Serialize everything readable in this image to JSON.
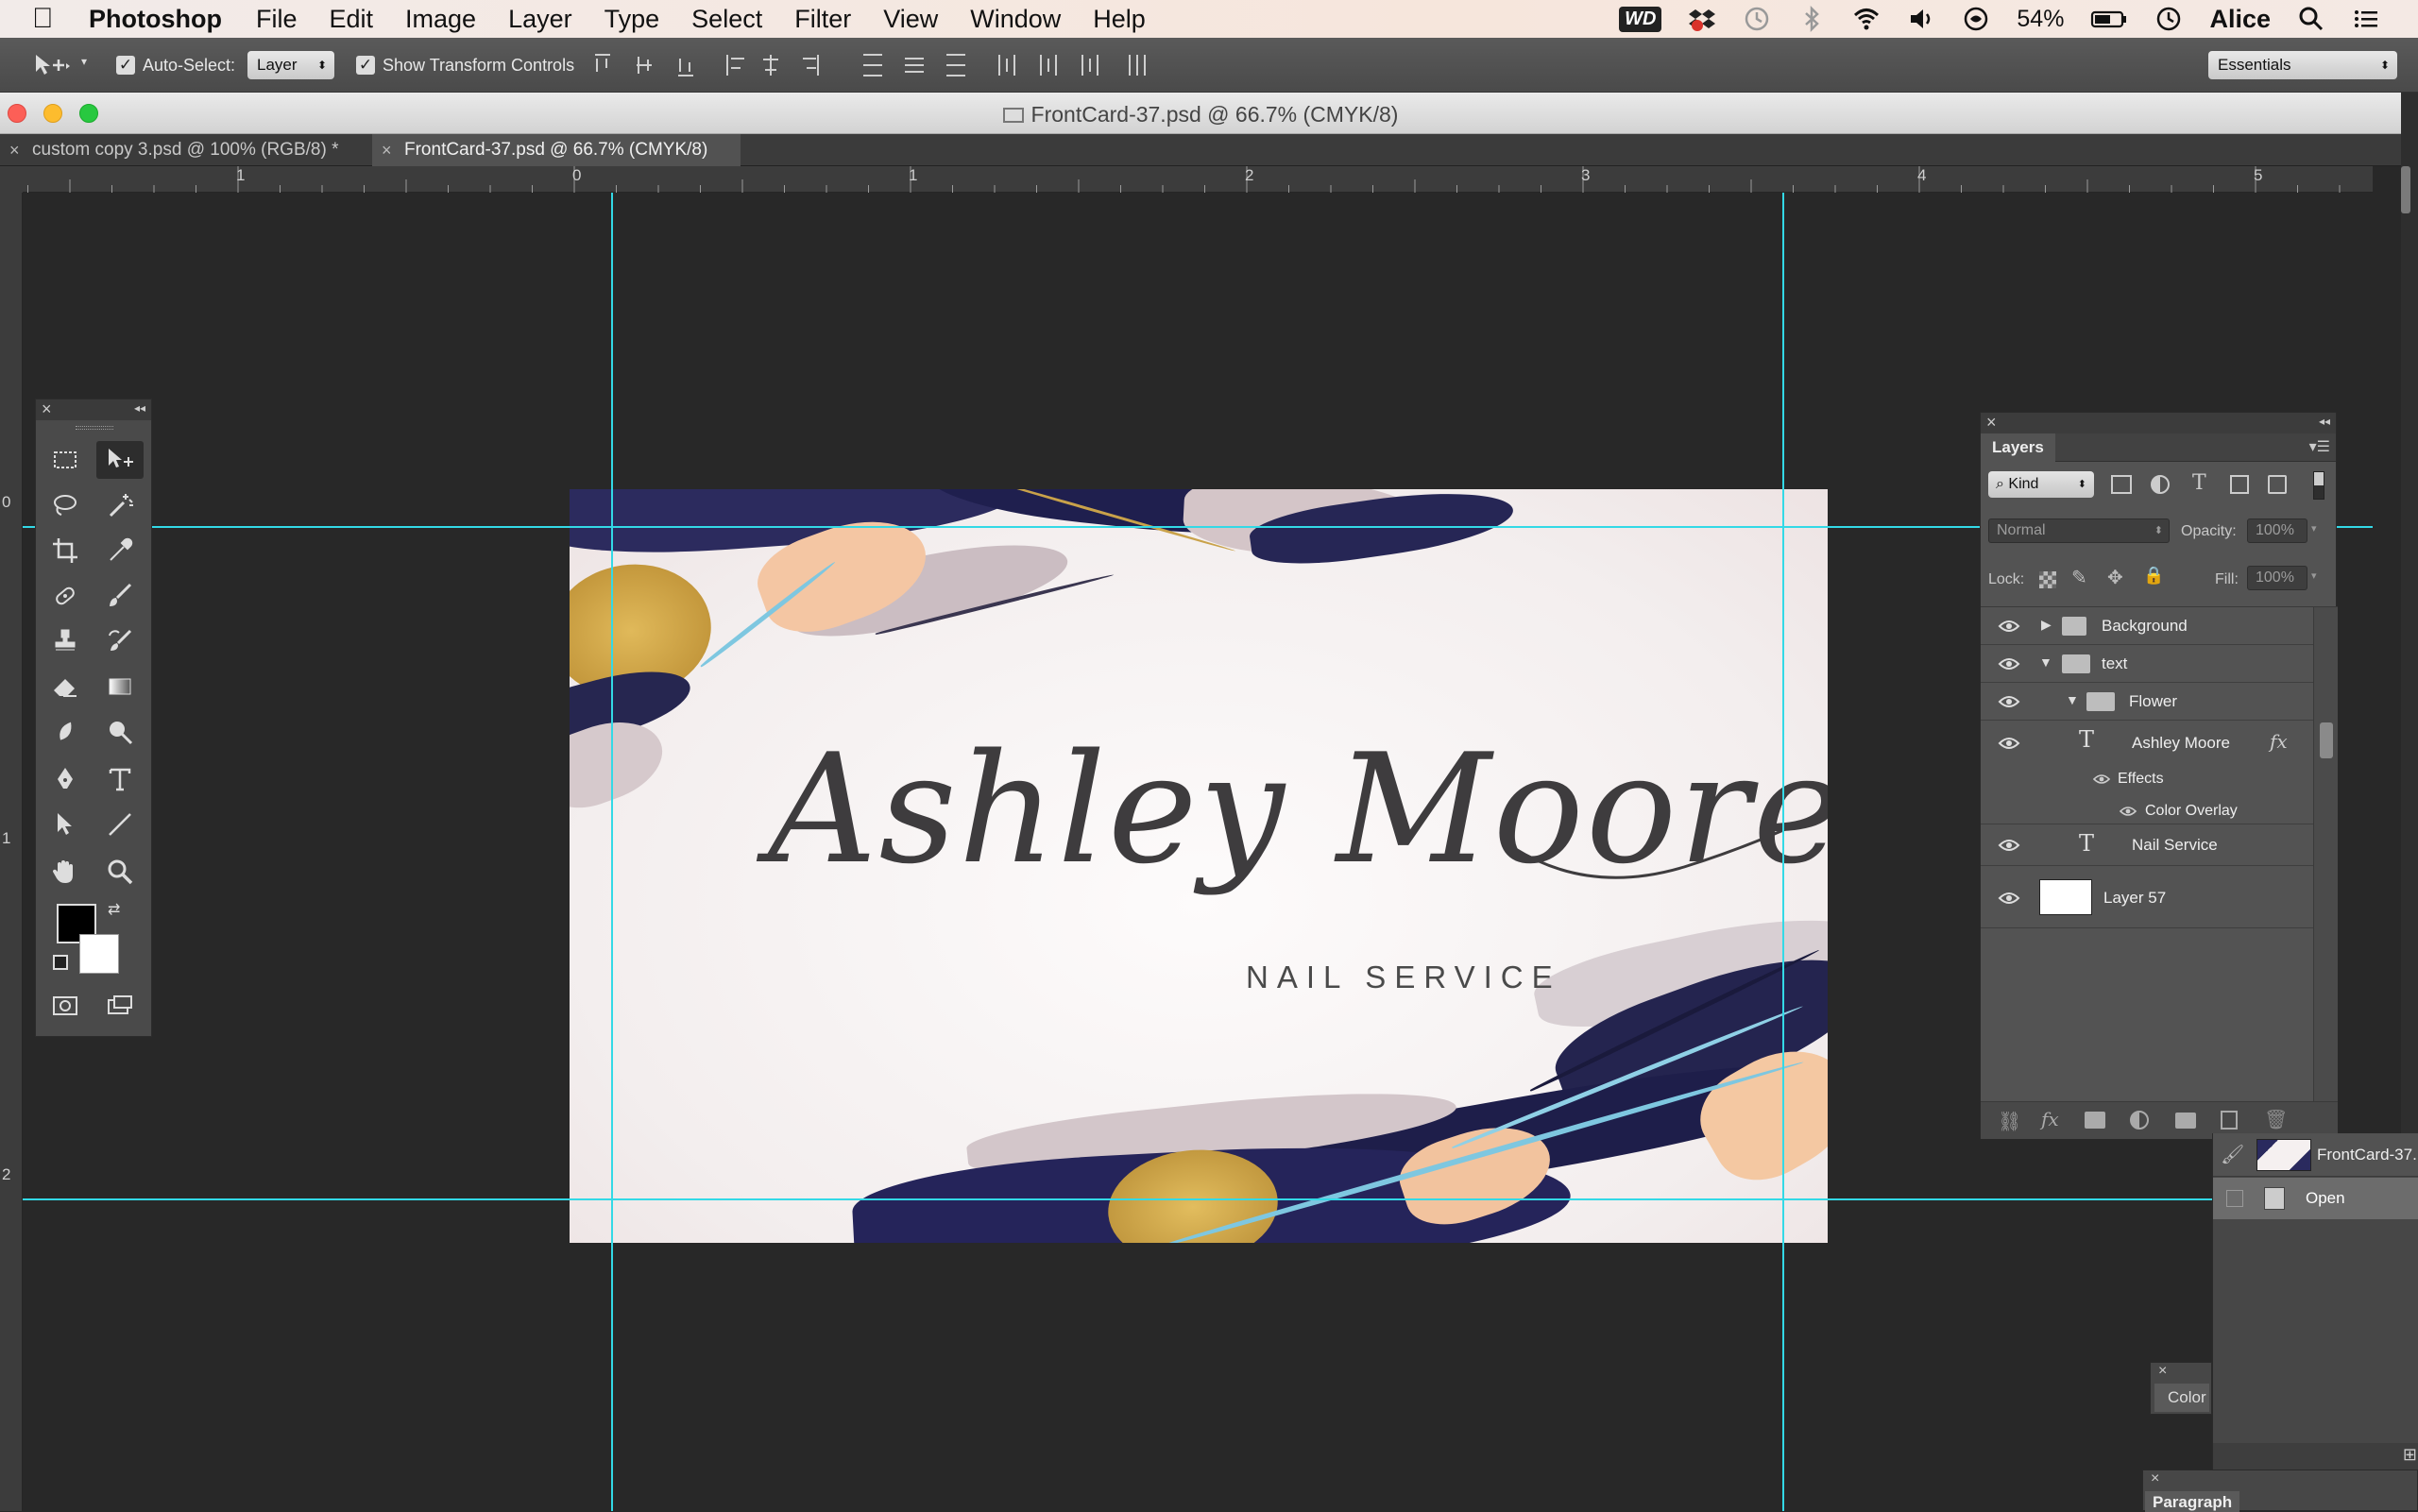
{
  "menubar": {
    "app_name": "Photoshop",
    "items": [
      "File",
      "Edit",
      "Image",
      "Layer",
      "Type",
      "Select",
      "Filter",
      "View",
      "Window",
      "Help"
    ],
    "wd_badge": "WD",
    "battery": "54%",
    "user": "Alice"
  },
  "options_bar": {
    "auto_select_label": "Auto-Select:",
    "auto_select_target": "Layer",
    "show_transform_label": "Show Transform Controls",
    "workspace": "Essentials"
  },
  "window": {
    "title": "FrontCard-37.psd @ 66.7% (CMYK/8)",
    "tabs": [
      {
        "label": "custom copy 3.psd @ 100% (RGB/8) *",
        "close": "×"
      },
      {
        "label": "FrontCard-37.psd @ 66.7% (CMYK/8)",
        "close": "×"
      }
    ]
  },
  "rulers": {
    "top": [
      "1",
      "0",
      "1",
      "2",
      "3",
      "4",
      "5"
    ],
    "left": [
      "0",
      "1",
      "2"
    ]
  },
  "artwork": {
    "name_text": "Ashley Moore",
    "subtitle_text": "NAIL SERVICE"
  },
  "tools_panel": {
    "close": "×",
    "collapse": "◂◂"
  },
  "layers_panel": {
    "close": "×",
    "collapse": "◂◂",
    "tab": "Layers",
    "filter_kind": "Kind",
    "blend_mode": "Normal",
    "opacity_label": "Opacity:",
    "opacity_value": "100%",
    "lock_label": "Lock:",
    "fill_label": "Fill:",
    "fill_value": "100%",
    "layers": [
      {
        "name": "Background",
        "kind": "group-collapsed"
      },
      {
        "name": "text",
        "kind": "group-expanded"
      },
      {
        "name": "Flower",
        "kind": "group-expanded"
      },
      {
        "name": "Ashley Moore",
        "kind": "text",
        "fx": "fx"
      },
      {
        "name": "Effects",
        "kind": "effects"
      },
      {
        "name": "Color Overlay",
        "kind": "effect"
      },
      {
        "name": "Nail Service",
        "kind": "text"
      },
      {
        "name": "Layer 57",
        "kind": "pixel"
      }
    ]
  },
  "history_panel": {
    "snapshot": "FrontCard-37.",
    "state": "Open"
  },
  "color_panel": {
    "close": "×",
    "label": "Color"
  },
  "paragraph_panel": {
    "close": "×",
    "label": "Paragraph"
  },
  "colors": {
    "guide": "#33d9e6",
    "navy": "#2a2a5e",
    "gold": "#c9a24a",
    "peach": "#f2c7a3",
    "blush": "#cfc0c4",
    "sky": "#6fc2df"
  }
}
